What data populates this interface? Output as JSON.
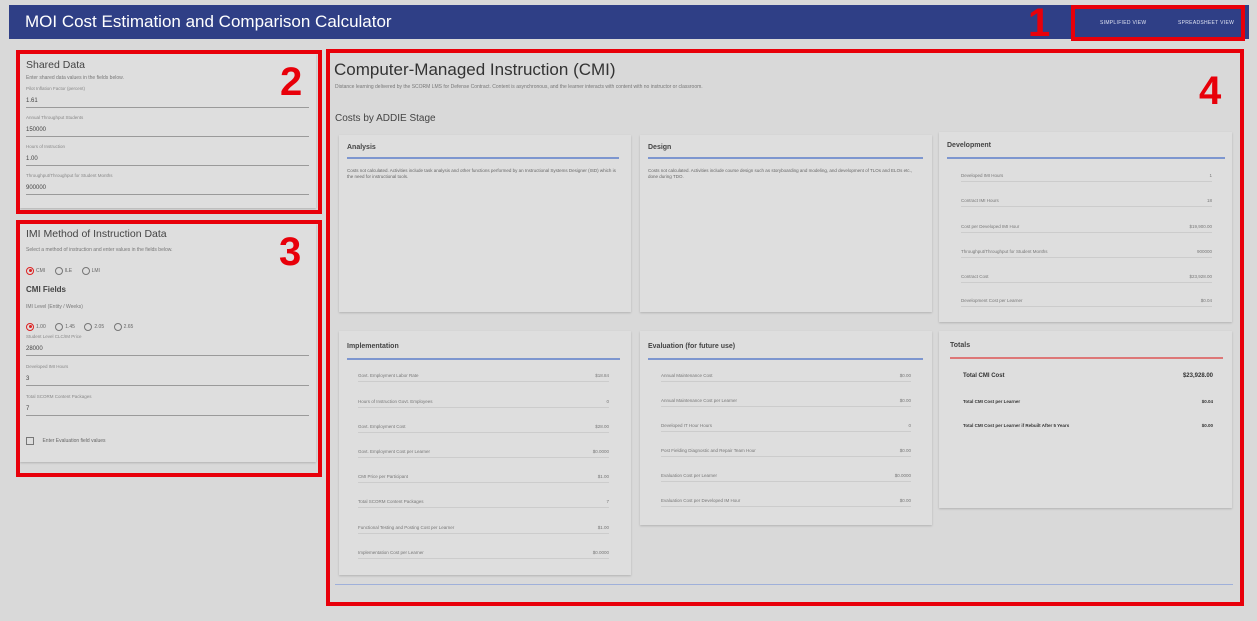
{
  "header": {
    "title": "MOI Cost Estimation and Comparison Calculator",
    "simplified_view": "Simplified View",
    "spreadsheet_view": "Spreadsheet View"
  },
  "callouts": [
    "1",
    "2",
    "3",
    "4"
  ],
  "shared_data": {
    "title": "Shared Data",
    "instructions": "Enter shared data values in the fields below.",
    "fields": [
      {
        "label": "Pilot Inflation Factor (percent)",
        "value": "1.61"
      },
      {
        "label": "Annual Throughput Students",
        "value": "150000"
      },
      {
        "label": "Hours of Instruction",
        "value": "1.00"
      },
      {
        "label": "Throughput/Throughput for Student Months",
        "value": "900000"
      }
    ]
  },
  "moi": {
    "title": "IMI Method of Instruction Data",
    "instructions": "Select a method of instruction and enter values in the fields below.",
    "methods": [
      "CMI",
      "ILE",
      "LMI"
    ],
    "selected_method": "CMI",
    "cmi_fields_title": "CMI Fields",
    "level_label": "IMI Level (Entity / Weeks)",
    "levels": [
      "1.00",
      "1.45",
      "2.05",
      "2.65"
    ],
    "selected_level": "1.00",
    "fields": [
      {
        "label": "Student Level CLC/IM Price",
        "value": "28000"
      },
      {
        "label": "Developed IMI Hours",
        "value": "3"
      },
      {
        "label": "Total SCORM Content Packages",
        "value": "7"
      }
    ],
    "checkbox_label": "Enter Evaluation field values"
  },
  "main": {
    "title": "Computer-Managed Instruction (CMI)",
    "subtitle": "Distance learning delivered by the SCORM LMS for Defense Contract. Content is asynchronous, and the learner interacts with content with no instructor or classroom.",
    "section_title": "Costs by ADDIE Stage",
    "analysis": {
      "title": "Analysis",
      "description": "Costs not calculated. Activities include task analysis and other functions performed by an Instructional Systems Designer (ISD) which is the need for instructional tools."
    },
    "design": {
      "title": "Design",
      "description": "Costs not calculated. Activities include course design such as storyboarding and modeling, and development of TLOs and ELOs etc., done during TDO."
    },
    "development": {
      "title": "Development",
      "rows": [
        {
          "k": "Developed IMI Hours",
          "v": "1"
        },
        {
          "k": "Contract IMI Hours",
          "v": "18"
        },
        {
          "k": "Cost per Developed IMI Hour",
          "v": "$19,900.00"
        },
        {
          "k": "Throughput/Throughput for Student Months",
          "v": "900000"
        },
        {
          "k": "Contract Cost",
          "v": "$23,928.00"
        },
        {
          "k": "Development Cost per Learner",
          "v": "$0.04"
        }
      ]
    },
    "implementation": {
      "title": "Implementation",
      "rows": [
        {
          "k": "Govt. Employment Labor Rate",
          "v": "$18.84"
        },
        {
          "k": "Hours of Instruction Govt. Employees",
          "v": "0"
        },
        {
          "k": "Govt. Employment Cost",
          "v": "$28.00"
        },
        {
          "k": "Govt. Employment Cost per Learner",
          "v": "$0.0000"
        },
        {
          "k": "CMI Price per Participant",
          "v": "$1.00"
        },
        {
          "k": "Total SCORM Content Packages",
          "v": "7"
        },
        {
          "k": "Functional Testing and Posting Cost per Learner",
          "v": "$1.00"
        },
        {
          "k": "Implementation Cost per Learner",
          "v": "$0.0000"
        }
      ]
    },
    "evaluation": {
      "title": "Evaluation (for future use)",
      "rows": [
        {
          "k": "Annual Maintenance Cost",
          "v": "$0.00"
        },
        {
          "k": "Annual Maintenance Cost per Learner",
          "v": "$0.00"
        },
        {
          "k": "Developed IT Hour Hours",
          "v": "0"
        },
        {
          "k": "Post Fielding Diagnostic and Repair Team Hour",
          "v": "$0.00"
        },
        {
          "k": "Evaluation Cost per Learner",
          "v": "$0.0000"
        },
        {
          "k": "Evaluation Cost per Developed IM Hour",
          "v": "$0.00"
        }
      ]
    },
    "totals": {
      "title": "Totals",
      "rows": [
        {
          "k": "Total CMI Cost",
          "v": "$23,928.00"
        },
        {
          "k": "Total CMI Cost per Learner",
          "v": "$0.04"
        },
        {
          "k": "Total CMI Cost per Learner if Rebuilt After 5 Years",
          "v": "$0.00"
        }
      ]
    }
  }
}
